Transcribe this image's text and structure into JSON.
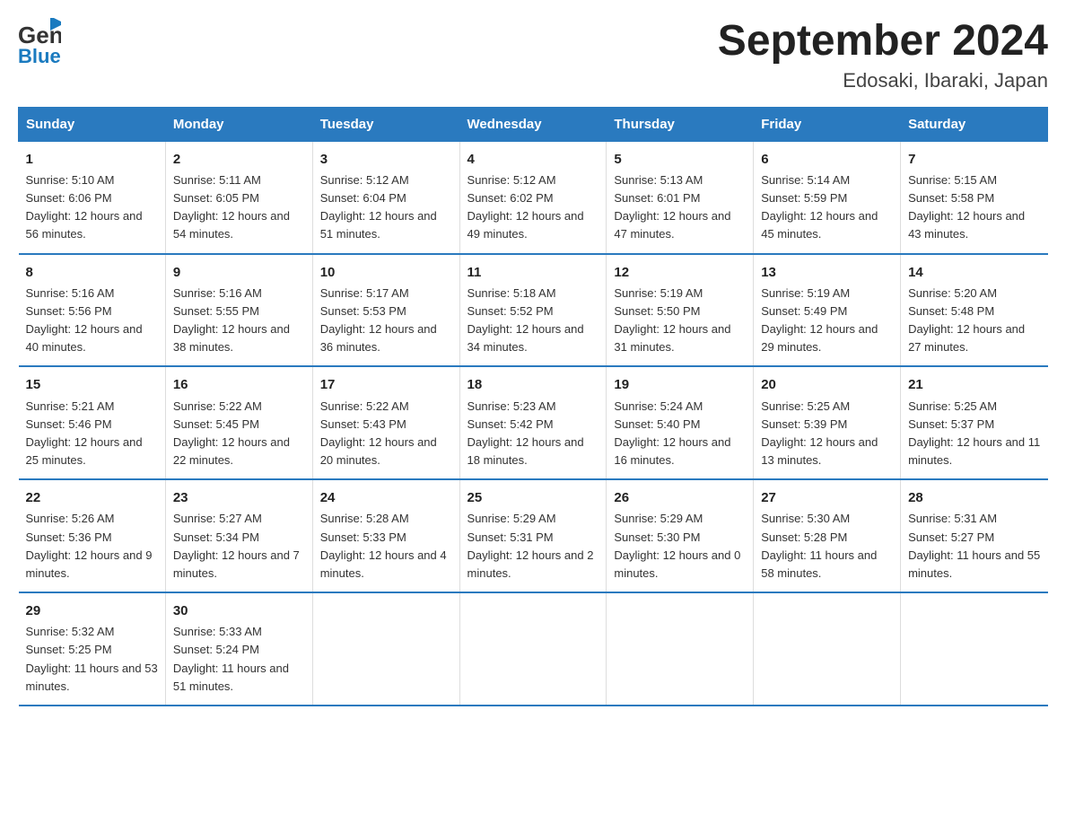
{
  "header": {
    "logo_general": "General",
    "logo_blue": "Blue",
    "month_title": "September 2024",
    "location": "Edosaki, Ibaraki, Japan"
  },
  "weekdays": [
    "Sunday",
    "Monday",
    "Tuesday",
    "Wednesday",
    "Thursday",
    "Friday",
    "Saturday"
  ],
  "weeks": [
    [
      {
        "day": "1",
        "sunrise": "5:10 AM",
        "sunset": "6:06 PM",
        "daylight": "12 hours and 56 minutes."
      },
      {
        "day": "2",
        "sunrise": "5:11 AM",
        "sunset": "6:05 PM",
        "daylight": "12 hours and 54 minutes."
      },
      {
        "day": "3",
        "sunrise": "5:12 AM",
        "sunset": "6:04 PM",
        "daylight": "12 hours and 51 minutes."
      },
      {
        "day": "4",
        "sunrise": "5:12 AM",
        "sunset": "6:02 PM",
        "daylight": "12 hours and 49 minutes."
      },
      {
        "day": "5",
        "sunrise": "5:13 AM",
        "sunset": "6:01 PM",
        "daylight": "12 hours and 47 minutes."
      },
      {
        "day": "6",
        "sunrise": "5:14 AM",
        "sunset": "5:59 PM",
        "daylight": "12 hours and 45 minutes."
      },
      {
        "day": "7",
        "sunrise": "5:15 AM",
        "sunset": "5:58 PM",
        "daylight": "12 hours and 43 minutes."
      }
    ],
    [
      {
        "day": "8",
        "sunrise": "5:16 AM",
        "sunset": "5:56 PM",
        "daylight": "12 hours and 40 minutes."
      },
      {
        "day": "9",
        "sunrise": "5:16 AM",
        "sunset": "5:55 PM",
        "daylight": "12 hours and 38 minutes."
      },
      {
        "day": "10",
        "sunrise": "5:17 AM",
        "sunset": "5:53 PM",
        "daylight": "12 hours and 36 minutes."
      },
      {
        "day": "11",
        "sunrise": "5:18 AM",
        "sunset": "5:52 PM",
        "daylight": "12 hours and 34 minutes."
      },
      {
        "day": "12",
        "sunrise": "5:19 AM",
        "sunset": "5:50 PM",
        "daylight": "12 hours and 31 minutes."
      },
      {
        "day": "13",
        "sunrise": "5:19 AM",
        "sunset": "5:49 PM",
        "daylight": "12 hours and 29 minutes."
      },
      {
        "day": "14",
        "sunrise": "5:20 AM",
        "sunset": "5:48 PM",
        "daylight": "12 hours and 27 minutes."
      }
    ],
    [
      {
        "day": "15",
        "sunrise": "5:21 AM",
        "sunset": "5:46 PM",
        "daylight": "12 hours and 25 minutes."
      },
      {
        "day": "16",
        "sunrise": "5:22 AM",
        "sunset": "5:45 PM",
        "daylight": "12 hours and 22 minutes."
      },
      {
        "day": "17",
        "sunrise": "5:22 AM",
        "sunset": "5:43 PM",
        "daylight": "12 hours and 20 minutes."
      },
      {
        "day": "18",
        "sunrise": "5:23 AM",
        "sunset": "5:42 PM",
        "daylight": "12 hours and 18 minutes."
      },
      {
        "day": "19",
        "sunrise": "5:24 AM",
        "sunset": "5:40 PM",
        "daylight": "12 hours and 16 minutes."
      },
      {
        "day": "20",
        "sunrise": "5:25 AM",
        "sunset": "5:39 PM",
        "daylight": "12 hours and 13 minutes."
      },
      {
        "day": "21",
        "sunrise": "5:25 AM",
        "sunset": "5:37 PM",
        "daylight": "12 hours and 11 minutes."
      }
    ],
    [
      {
        "day": "22",
        "sunrise": "5:26 AM",
        "sunset": "5:36 PM",
        "daylight": "12 hours and 9 minutes."
      },
      {
        "day": "23",
        "sunrise": "5:27 AM",
        "sunset": "5:34 PM",
        "daylight": "12 hours and 7 minutes."
      },
      {
        "day": "24",
        "sunrise": "5:28 AM",
        "sunset": "5:33 PM",
        "daylight": "12 hours and 4 minutes."
      },
      {
        "day": "25",
        "sunrise": "5:29 AM",
        "sunset": "5:31 PM",
        "daylight": "12 hours and 2 minutes."
      },
      {
        "day": "26",
        "sunrise": "5:29 AM",
        "sunset": "5:30 PM",
        "daylight": "12 hours and 0 minutes."
      },
      {
        "day": "27",
        "sunrise": "5:30 AM",
        "sunset": "5:28 PM",
        "daylight": "11 hours and 58 minutes."
      },
      {
        "day": "28",
        "sunrise": "5:31 AM",
        "sunset": "5:27 PM",
        "daylight": "11 hours and 55 minutes."
      }
    ],
    [
      {
        "day": "29",
        "sunrise": "5:32 AM",
        "sunset": "5:25 PM",
        "daylight": "11 hours and 53 minutes."
      },
      {
        "day": "30",
        "sunrise": "5:33 AM",
        "sunset": "5:24 PM",
        "daylight": "11 hours and 51 minutes."
      },
      {
        "day": "",
        "sunrise": "",
        "sunset": "",
        "daylight": ""
      },
      {
        "day": "",
        "sunrise": "",
        "sunset": "",
        "daylight": ""
      },
      {
        "day": "",
        "sunrise": "",
        "sunset": "",
        "daylight": ""
      },
      {
        "day": "",
        "sunrise": "",
        "sunset": "",
        "daylight": ""
      },
      {
        "day": "",
        "sunrise": "",
        "sunset": "",
        "daylight": ""
      }
    ]
  ]
}
